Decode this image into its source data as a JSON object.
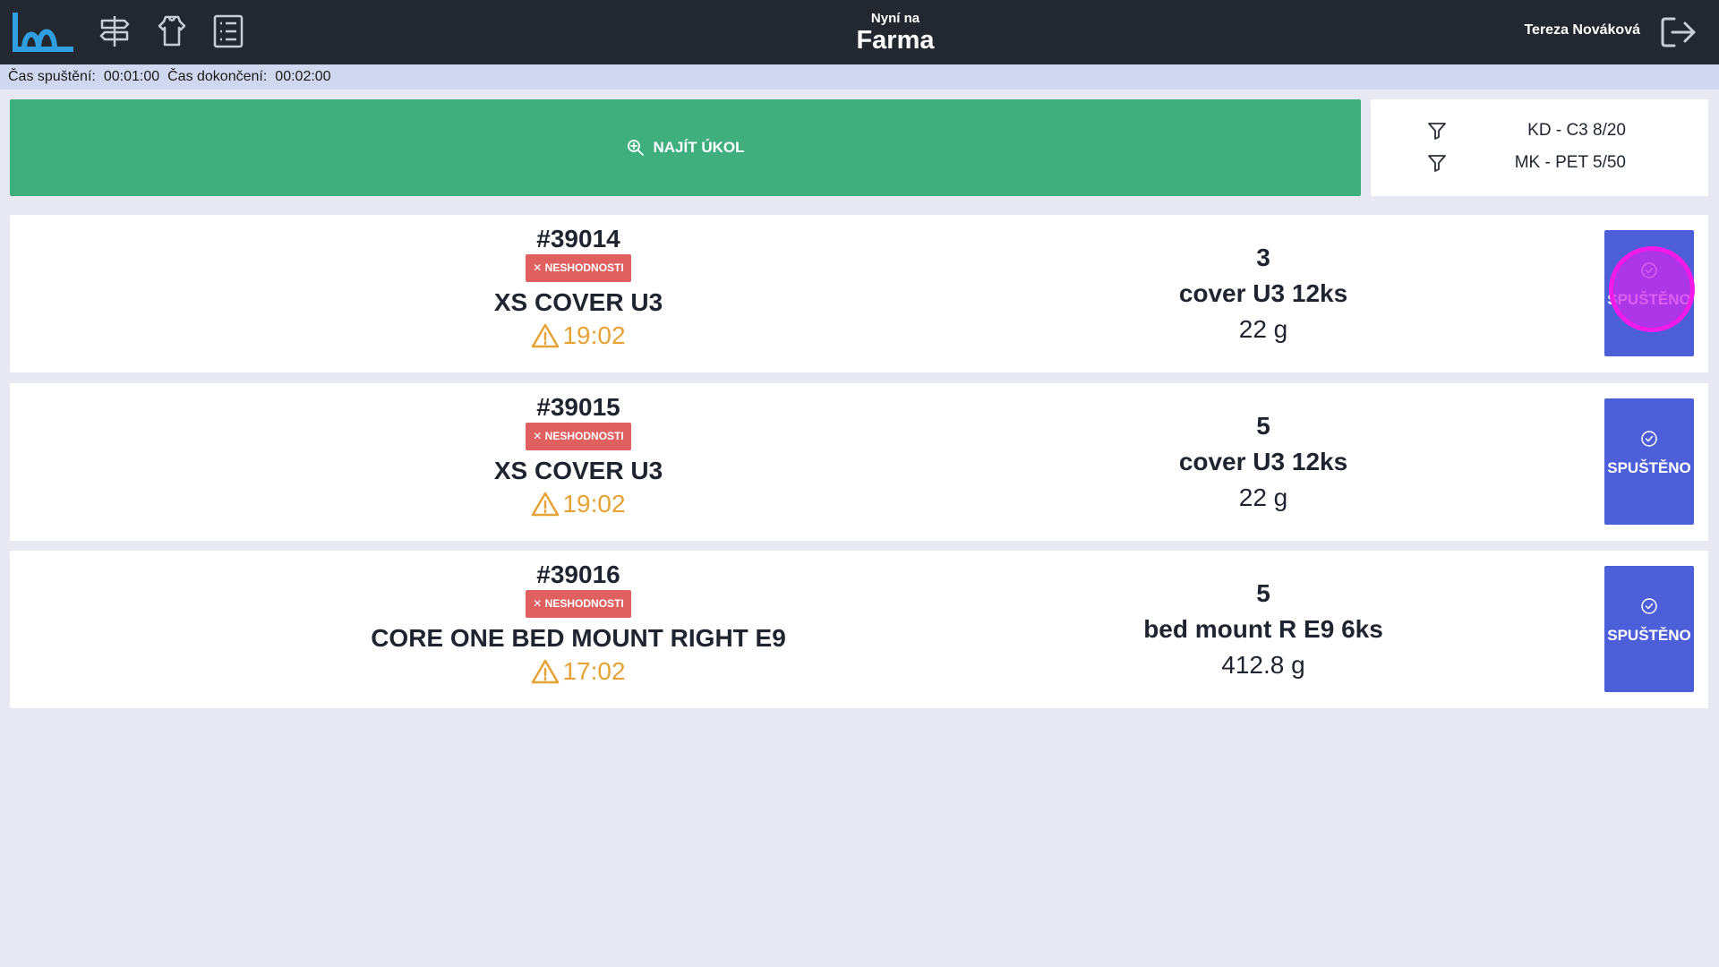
{
  "header": {
    "subtitle": "Nyní na",
    "title": "Farma",
    "user_name": "Tereza Nováková"
  },
  "nav_icons": [
    "logo-icon",
    "signpost-icon",
    "spool-icon",
    "list-icon"
  ],
  "infobar": {
    "start_label": "Čas spuštění:",
    "start_value": "00:01:00",
    "end_label": "Čas dokončení:",
    "end_value": "00:02:00"
  },
  "find_button": {
    "label": "NAJÍT ÚKOL"
  },
  "filters": [
    {
      "text": "KD - C3  8/20"
    },
    {
      "text": "MK - PET  5/50"
    }
  ],
  "tasks": [
    {
      "id": "#39014",
      "badge": "✕ NESHODNOSTI",
      "product": "XS COVER U3",
      "due": "19:02",
      "qty": "3",
      "part": "cover U3 12ks",
      "weight": "22 g",
      "button": "SPUŠTĚNO"
    },
    {
      "id": "#39015",
      "badge": "✕ NESHODNOSTI",
      "product": "XS COVER U3",
      "due": "19:02",
      "qty": "5",
      "part": "cover U3 12ks",
      "weight": "22 g",
      "button": "SPUŠTĚNO"
    },
    {
      "id": "#39016",
      "badge": "✕ NESHODNOSTI",
      "product": "CORE ONE BED MOUNT RIGHT E9",
      "due": "17:02",
      "qty": "5",
      "part": "bed mount R E9 6ks",
      "weight": "412.8 g",
      "button": "SPUŠTĚNO"
    }
  ],
  "colors": {
    "topbar": "#232830",
    "find_button": "#3faf7e",
    "start_button": "#4d5fd8",
    "badge": "#e06060",
    "warning": "#e6a235",
    "click_marker": "#f41be8"
  }
}
